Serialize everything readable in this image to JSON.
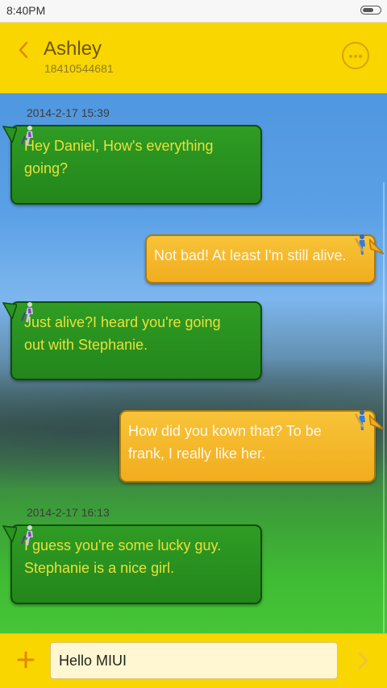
{
  "status_bar": {
    "time": "8:40PM"
  },
  "header": {
    "contact_name": "Ashley",
    "contact_number": "18410544681"
  },
  "conversation": {
    "timestamps": [
      "2014-2-17 15:39",
      "2014-2-17 16:13"
    ],
    "messages": [
      {
        "direction": "incoming",
        "lines": [
          "Hey Daniel, How's everything",
          "going?"
        ]
      },
      {
        "direction": "outgoing",
        "lines": [
          "Not bad! At least I'm still alive."
        ]
      },
      {
        "direction": "incoming",
        "lines": [
          "Just  alive?I heard you're going",
          "out with Stephanie."
        ]
      },
      {
        "direction": "outgoing",
        "lines": [
          "How did you kown that? To be",
          "frank, I really like her."
        ]
      },
      {
        "direction": "incoming",
        "lines": [
          "I guess you're some lucky guy.",
          "Stephanie is a nice girl."
        ]
      }
    ]
  },
  "compose": {
    "value": "Hello MIUI"
  },
  "icons": {
    "back": "chevron-left-icon",
    "more": "more-dots-icon",
    "add": "plus-icon",
    "send": "chevron-right-icon",
    "incoming_avatar": "cricket-player-icon",
    "outgoing_avatar": "cricket-batsman-icon"
  },
  "colors": {
    "theme_yellow": "#f9d600",
    "incoming_bubble": "#2f9c24",
    "incoming_text": "#e8e13a",
    "outgoing_bubble": "#f8c338",
    "outgoing_text": "#fff8e8",
    "accent_orange": "#e08a00"
  }
}
